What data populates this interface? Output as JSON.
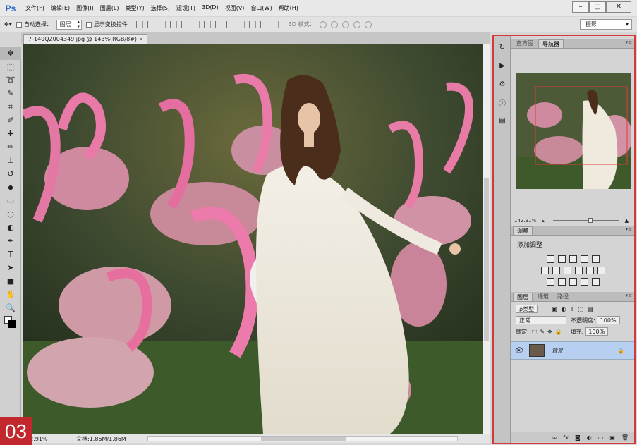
{
  "app": {
    "logo": "Ps"
  },
  "menu": [
    "文件(F)",
    "编辑(E)",
    "图像(I)",
    "图层(L)",
    "类型(Y)",
    "选择(S)",
    "滤镜(T)",
    "3D(D)",
    "视图(V)",
    "窗口(W)",
    "帮助(H)"
  ],
  "window_buttons": {
    "minimize": "–",
    "maximize": "□",
    "close": "✕"
  },
  "options": {
    "auto_select_label": "自动选择：",
    "auto_select_value": "图层",
    "show_transform": "显示变换控件",
    "mode_3d": "3D 模式：",
    "workspace": "摄影"
  },
  "document": {
    "tab": "7-140Q2004349.jpg @ 143%(RGB/8#)",
    "close": "×"
  },
  "status": {
    "zoom": "142.91%",
    "doc_info": "文档:1.86M/1.86M"
  },
  "badge": "03",
  "tools": [
    "move-icon",
    "marquee-icon",
    "lasso-icon",
    "quick-select-icon",
    "crop-icon",
    "eyedropper-icon",
    "healing-icon",
    "brush-icon",
    "stamp-icon",
    "history-brush-icon",
    "eraser-icon",
    "gradient-icon",
    "blur-icon",
    "dodge-icon",
    "pen-icon",
    "type-icon",
    "path-select-icon",
    "shape-icon",
    "hand-icon",
    "zoom-icon"
  ],
  "tool_glyphs": [
    "✥",
    "⬚",
    "➰",
    "✎",
    "⌗",
    "✐",
    "✚",
    "✏",
    "⊥",
    "↺",
    "◆",
    "▭",
    "○",
    "◐",
    "✒",
    "T",
    "➤",
    "■",
    "✋",
    "🔍"
  ],
  "side_icons": [
    "history-icon",
    "play-icon",
    "properties-icon",
    "info-icon",
    "stamp-panel-icon"
  ],
  "side_glyphs": [
    "↻",
    "▶",
    "⚙",
    "ⓘ",
    "▤"
  ],
  "nav_panel": {
    "tabs": [
      "直方图",
      "导航器"
    ],
    "active": 1,
    "zoom": "142.91%"
  },
  "adj_panel": {
    "tab": "调整",
    "title": "添加调整"
  },
  "layers_panel": {
    "tabs": [
      "图层",
      "通道",
      "路径"
    ],
    "active": 0,
    "filter": "ρ类型",
    "blend_mode": "正常",
    "opacity_label": "不透明度:",
    "opacity": "100%",
    "lock_label": "锁定:",
    "fill_label": "填充:",
    "fill": "100%",
    "layer_name": "背景"
  },
  "layers_footer": [
    "∞",
    "fx",
    "◙",
    "◐",
    "▭",
    "▣",
    "🗑"
  ]
}
